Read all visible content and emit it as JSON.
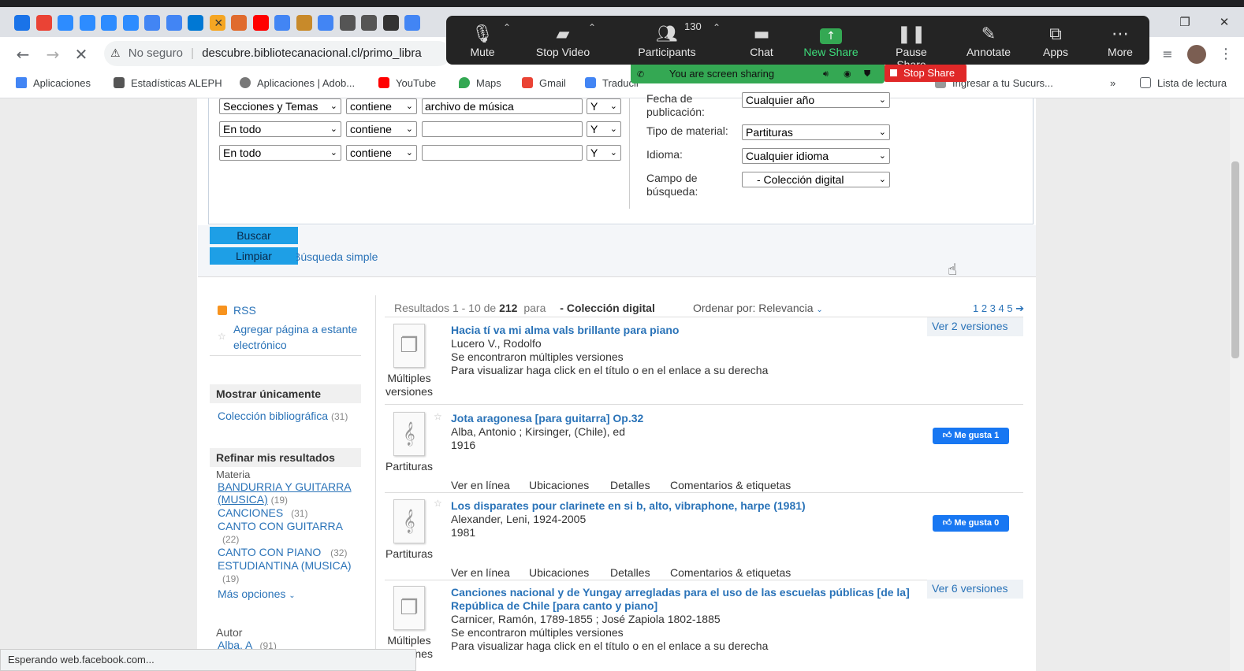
{
  "browser": {
    "tabs_icons": [
      "calendar-icon",
      "gmail-icon",
      "zoom-icon",
      "zoom-icon",
      "zoom-icon",
      "zoom-icon",
      "chrome-icon",
      "chrome-icon",
      "outlook-icon",
      "arc-icon",
      "arc-icon",
      "youtube-icon",
      "google-icon",
      "butterfly-icon",
      "google-icon",
      "globe-icon",
      "globe-icon",
      "github-icon",
      "chrome-icon"
    ],
    "tab_close": "×",
    "security": "No seguro",
    "url": "descubre.bibliotecanacional.cl/primo_libra",
    "bookmarks": [
      {
        "label": "Aplicaciones",
        "icon": "apps-grid-icon"
      },
      {
        "label": "Estadísticas ALEPH",
        "icon": "library-icon"
      },
      {
        "label": "Aplicaciones | Adob...",
        "icon": "adobe-icon"
      },
      {
        "label": "YouTube",
        "icon": "youtube-icon"
      },
      {
        "label": "Maps",
        "icon": "maps-pin-icon"
      },
      {
        "label": "Gmail",
        "icon": "gmail-icon"
      },
      {
        "label": "Traducir",
        "icon": "translate-icon"
      },
      {
        "label": "Ingresar a tu Sucurs...",
        "icon": "bank-icon"
      }
    ],
    "more_bookmarks": "»",
    "reading_list": "Lista de lectura",
    "status": "Esperando web.facebook.com..."
  },
  "zoom": {
    "buttons": [
      {
        "label": "Mute",
        "icon": "microphone-icon"
      },
      {
        "label": "Stop Video",
        "icon": "video-camera-icon"
      },
      {
        "label": "Participants",
        "icon": "participants-icon",
        "count": "130"
      },
      {
        "label": "Chat",
        "icon": "chat-icon"
      },
      {
        "label": "New Share",
        "icon": "share-up-arrow-icon"
      },
      {
        "label": "Pause Share",
        "icon": "pause-icon"
      },
      {
        "label": "Annotate",
        "icon": "pencil-icon"
      },
      {
        "label": "Apps",
        "icon": "apps-icon"
      },
      {
        "label": "More",
        "icon": "more-dots-icon"
      }
    ],
    "sharing_text": "You are screen sharing",
    "stop_share": "Stop Share",
    "colors": {
      "toolbar": "#242424",
      "new_share": "#34a853",
      "stop": "#e02828"
    }
  },
  "search_form": {
    "rows": [
      {
        "scope": "Secciones y Temas",
        "op": "contiene",
        "value": "archivo de música",
        "bool": "Y"
      },
      {
        "scope": "En todo",
        "op": "contiene",
        "value": "",
        "bool": "Y"
      },
      {
        "scope": "En todo",
        "op": "contiene",
        "value": "",
        "bool": "Y"
      }
    ],
    "filters": [
      {
        "label": "Fecha de publicación:",
        "value": "Cualquier año"
      },
      {
        "label": "Tipo de material:",
        "value": "Partituras"
      },
      {
        "label": "Idioma:",
        "value": "Cualquier idioma"
      },
      {
        "label": "Campo de búsqueda:",
        "value": "- Colección digital"
      }
    ],
    "buscar": "Buscar",
    "limpiar": "Limpiar",
    "simple": "Búsqueda simple"
  },
  "sidebar": {
    "rss": "RSS",
    "shelf": "Agregar página a estante electrónico",
    "show_only": "Mostrar únicamente",
    "collection": {
      "label": "Colección bibliográfica",
      "count": "(31)"
    },
    "refine": "Refinar mis resultados",
    "materia": "Materia",
    "facets": [
      {
        "label": "BANDURRIA Y GUITARRA (MUSICA)",
        "count": "(19)"
      },
      {
        "label": "CANCIONES",
        "count": "(31)"
      },
      {
        "label": "CANTO CON GUITARRA",
        "count": "(22)"
      },
      {
        "label": "CANTO CON PIANO",
        "count": "(32)"
      },
      {
        "label": "ESTUDIANTINA (MUSICA)",
        "count": "(19)"
      }
    ],
    "more": "Más opciones",
    "autor": "Autor",
    "autor_first": {
      "label": "Alba, A",
      "count": "(91)"
    }
  },
  "results": {
    "summary_pre": "Resultados",
    "range": "1 - 10",
    "of": "de",
    "total": "212",
    "para": "para",
    "scope": "- Colección digital",
    "sort_label": "Ordenar por:",
    "sort_value": "Relevancia",
    "pages": "1 2 3 4 5",
    "records": [
      {
        "title": "Hacia tí va mi alma vals brillante para piano",
        "lines": [
          "Lucero V., Rodolfo",
          "Se encontraron múltiples versiones",
          "Para visualizar haga click en el título o en el enlace a su derecha"
        ],
        "type": "Múltiples versiones",
        "versions": "Ver 2 versiones"
      },
      {
        "title": "Jota aragonesa [para guitarra] Op.32",
        "lines": [
          "Alba, Antonio ; Kirsinger, (Chile), ed",
          "1916"
        ],
        "type": "Partituras",
        "like": "Me gusta 1",
        "actions": [
          "Ver en línea",
          "Ubicaciones",
          "Detalles",
          "Comentarios & etiquetas"
        ]
      },
      {
        "title": "Los disparates pour clarinete en si b, alto, vibraphone, harpe (1981)",
        "lines": [
          "Alexander, Leni, 1924-2005",
          "1981"
        ],
        "type": "Partituras",
        "like": "Me gusta 0",
        "actions": [
          "Ver en línea",
          "Ubicaciones",
          "Detalles",
          "Comentarios & etiquetas"
        ]
      },
      {
        "title1": "Canciones nacional y de Yungay arregladas para el uso de las escuelas públicas [de la]",
        "title2": "República de Chile [para canto y piano]",
        "lines": [
          "Carnicer, Ramón, 1789-1855 ; José Zapiola 1802-1885",
          "Se encontraron múltiples versiones",
          "Para visualizar haga click en el título o en el enlace a su derecha"
        ],
        "type": "Múltiples versiones",
        "versions": "Ver 6 versiones"
      }
    ]
  }
}
